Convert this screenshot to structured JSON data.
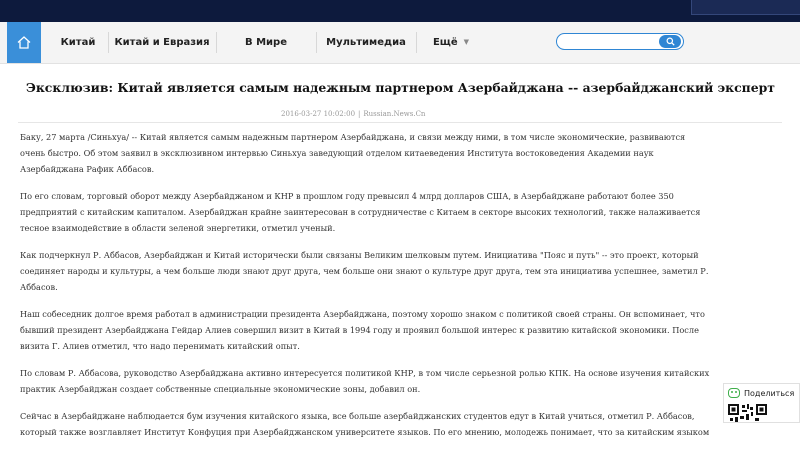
{
  "nav": {
    "home_icon": "home-icon",
    "items": [
      {
        "label": "Китай"
      },
      {
        "label": "Китай и Евразия"
      },
      {
        "label": "В Мире"
      },
      {
        "label": "Мультимедиа"
      },
      {
        "label": "Ещё",
        "dropdown": true
      }
    ],
    "search": {
      "value": "",
      "placeholder": "",
      "icon": "search-icon"
    }
  },
  "article": {
    "title": "Эксклюзив: Китай является самым надежным партнером Азербайджана -- азербайджанский эксперт",
    "datetime": "2016-03-27 10:02:00",
    "source": "Russian.News.Cn",
    "paragraphs": [
      "Баку, 27 марта /Синьхуа/ -- Китай является самым надежным партнером Азербайджана, и связи между ними, в том числе экономические, развиваются очень быстро. Об этом заявил в эксклюзивном интервью Синьхуа заведующий отделом китаеведения Института востоковедения Академии наук Азербайджана Рафик Аббасов.",
      "По его словам, торговый оборот между Азербайджаном и КНР в прошлом году превысил 4 млрд долларов США, в Азербайджане работают более 350 предприятий с китайским капиталом. Азербайджан крайне заинтересован в сотрудничестве с Китаем в секторе высоких технологий, также налаживается тесное взаимодействие в области зеленой энергетики, отметил ученый.",
      "Как подчеркнул Р. Аббасов, Азербайджан и Китай исторически были связаны Великим шелковым путем. Инициатива \"Пояс и путь\" -- это проект, который соединяет народы и культуры, а чем больше люди знают друг друга, чем больше они знают о культуре друг друга, тем эта инициатива успешнее, заметил Р. Аббасов.",
      "Наш собеседник долгое время работал в администрации президента Азербайджана, поэтому хорошо знаком с политикой своей страны. Он вспоминает, что бывший президент Азербайджана Гейдар Алиев совершил визит в Китай в 1994 году и проявил большой интерес к развитию китайской экономики. После визита Г. Алиев отметил, что надо перенимать китайский опыт.",
      "По словам Р. Аббасова, руководство Азербайджана активно интересуется политикой КНР, в том числе серьезной ролью КПК. На основе изучения китайских практик Азербайджан создает собственные специальные экономические зоны, добавил он.",
      "Сейчас в Азербайджане наблюдается бум изучения китайского языка, все больше азербайджанских студентов едут в Китай учиться, отметил Р. Аббасов, который также возглавляет Институт Конфуция при Азербайджанском университете языков. По его мнению, молодежь понимает, что за китайским языком"
    ]
  },
  "share": {
    "label": "Поделиться",
    "icon": "wechat-icon",
    "qr_icon": "qr-code-icon"
  },
  "colors": {
    "top_bar": "#0d1a3d",
    "nav_bg": "#f4f4f4",
    "accent": "#3a8fd9",
    "search_border": "#2f86d4",
    "wechat_green": "#3fae4a"
  }
}
